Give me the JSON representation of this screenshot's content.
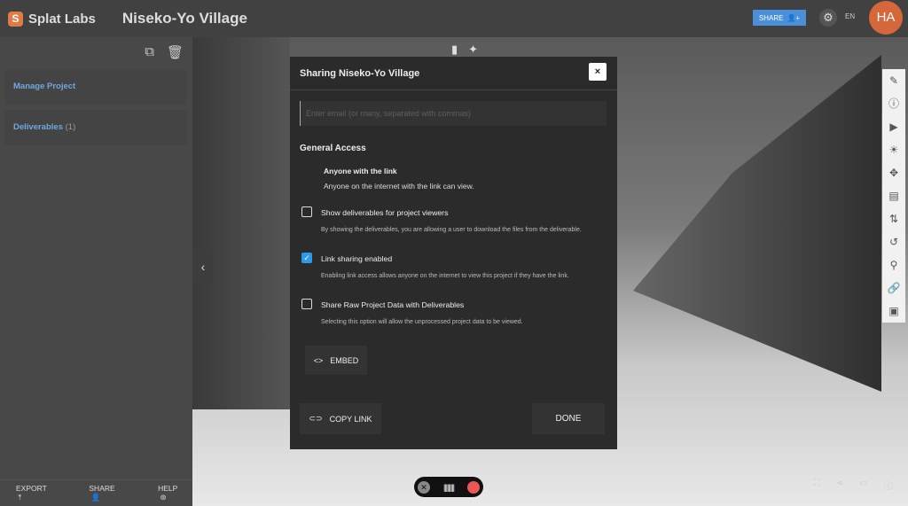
{
  "header": {
    "brand": "Splat Labs",
    "logo_letter": "S",
    "project_title": "Niseko-Yo Village",
    "share_label": "SHARE",
    "language": "EN",
    "avatar_initials": "HA"
  },
  "sidebar": {
    "items": [
      {
        "label": "Manage Project"
      },
      {
        "label": "Deliverables",
        "count": "(1)"
      }
    ],
    "footer": {
      "export": "EXPORT",
      "share": "SHARE",
      "help": "HELP"
    }
  },
  "modal": {
    "title": "Sharing Niseko-Yo Village",
    "close": "×",
    "email_placeholder": "Enter email (or many, separated with commas)",
    "general_access": "General Access",
    "access_title": "Anyone with the link",
    "access_desc": "Anyone on the internet with the link can view.",
    "options": [
      {
        "label": "Show deliverables for project viewers",
        "desc": "By showing the deliverables, you are allowing a user to download the files from the deliverable.",
        "checked": false
      },
      {
        "label": "Link sharing enabled",
        "desc": "Enabling link access allows anyone on the internet to view this project if they have the link.",
        "checked": true
      },
      {
        "label": "Share Raw Project Data with Deliverables",
        "desc": "Selecting this option will allow the unprocessed project data to be viewed.",
        "checked": false
      }
    ],
    "embed": "EMBED",
    "copy_link": "COPY LINK",
    "done": "DONE"
  },
  "colors": {
    "accent": "#4a8fd9",
    "brand": "#e07b45",
    "checkbox": "#2b9ae8"
  }
}
